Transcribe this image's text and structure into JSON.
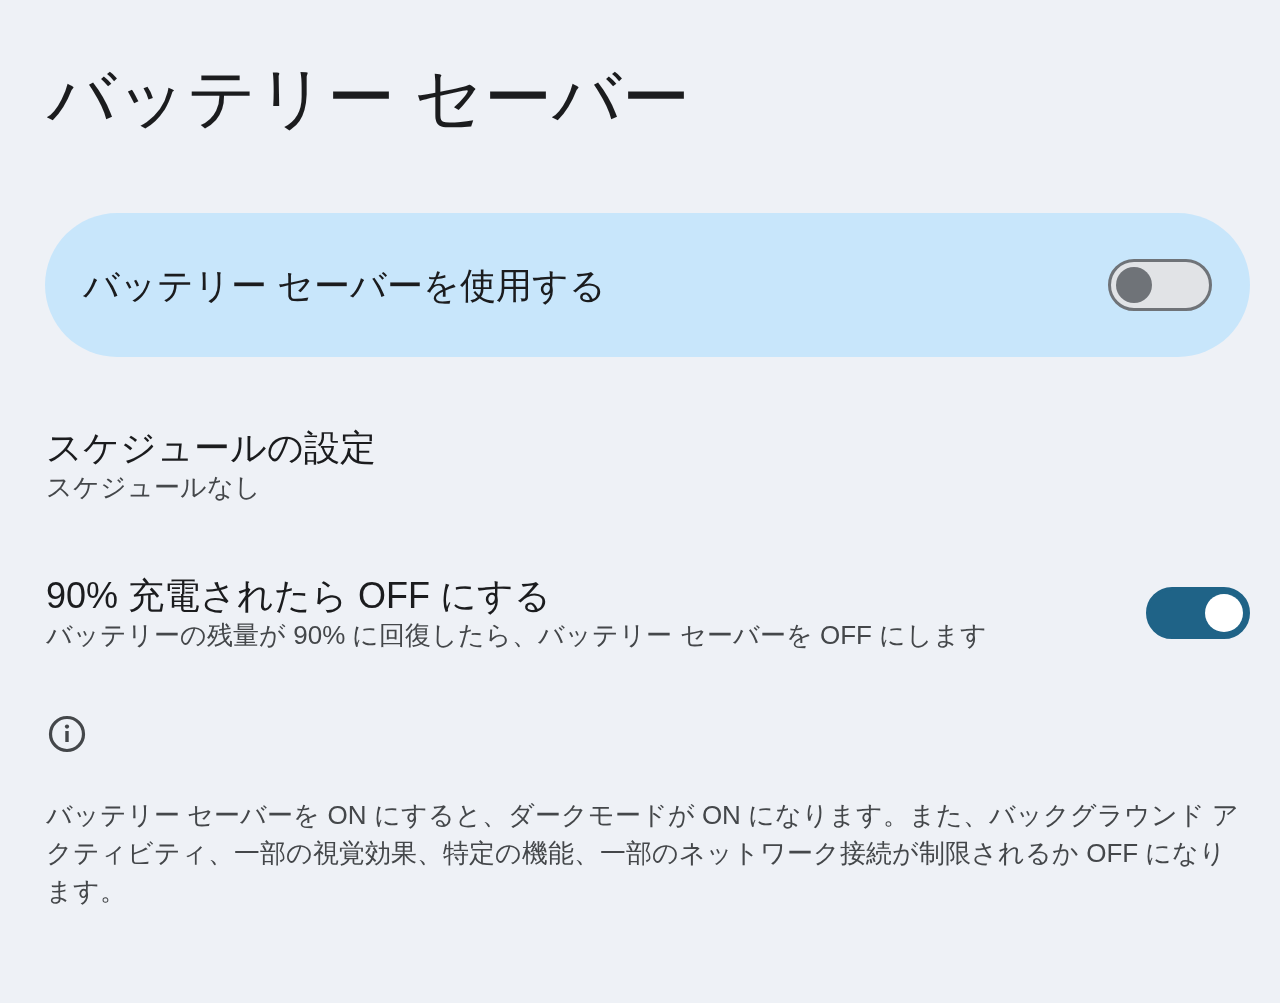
{
  "title": "バッテリー セーバー",
  "main_switch": {
    "label": "バッテリー セーバーを使用する",
    "on": false
  },
  "settings": [
    {
      "kind": "link",
      "title": "スケジュールの設定",
      "summary": "スケジュールなし"
    },
    {
      "kind": "switch",
      "title": "90% 充電されたら OFF にする",
      "summary": "バッテリーの残量が 90% に回復したら、バッテリー セーバーを OFF にします",
      "on": true
    }
  ],
  "footer": {
    "text": "バッテリー セーバーを ON にすると、ダークモードが ON になります。また、バックグラウンド アクティビティ、一部の視覚効果、特定の機能、一部のネットワーク接続が制限されるか OFF になります。"
  }
}
